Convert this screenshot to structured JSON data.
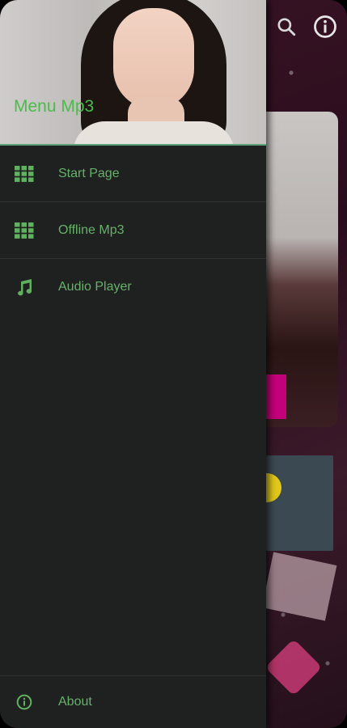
{
  "colors": {
    "accent": "#4cbb4c",
    "menu_text": "#67b06a",
    "drawer_bg": "#1f2121",
    "divider": "#2e3131"
  },
  "app": {
    "topbar": {
      "icons": [
        "search-icon",
        "info-icon"
      ]
    }
  },
  "drawer": {
    "header_title": "Menu Mp3",
    "items": [
      {
        "label": "Start Page",
        "icon": "grid-icon"
      },
      {
        "label": "Offline Mp3",
        "icon": "grid-icon"
      },
      {
        "label": "Audio Player",
        "icon": "music-note-icon"
      }
    ],
    "footer": {
      "label": "About",
      "icon": "info-icon"
    }
  }
}
